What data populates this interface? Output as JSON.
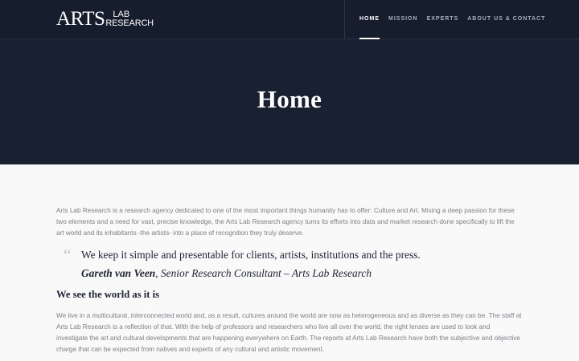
{
  "header": {
    "logo": {
      "arts": "ARTS",
      "lab": "LAB",
      "research": "RESEARCH"
    },
    "nav": [
      {
        "label": "HOME",
        "active": true
      },
      {
        "label": "MISSION",
        "active": false
      },
      {
        "label": "EXPERTS",
        "active": false
      },
      {
        "label": "ABOUT US & CONTACT",
        "active": false
      }
    ]
  },
  "hero": {
    "title": "Home"
  },
  "main": {
    "intro": "Arts Lab Research is a research agency dedicated to one of the most important things humanity has to offer: Culture and Art. Mixing a deep passion for these two elements and a need for vast, precise knowledge, the Arts Lab Research agency turns its efforts into data and market research done specifically to lift the art world and its inhabitants -the artists- into a place of recognition they truly deserve.",
    "quote": {
      "mark": "“",
      "text": "We keep it simple and presentable for clients, artists, institutions and the press.",
      "cite_name": "Gareth van Veen",
      "cite_role": ", Senior Research Consultant – Arts Lab Research"
    },
    "section_heading": "We see the world as it is",
    "body": "We live in a multicultural, interconnected world and, as a result, cultures around the world are now as heterogeneous and as diverse as they can be. The staff at Arts Lab Research is a reflection of that. With the help of professors and researchers who live all over the world, the right lenses are used to look and investigate the art and cultural developments that are happening everywhere on Earth. The reports at Arts Lab Research have both the subjective and objective charge that can be expected from natives and experts of any cultural and artistic movement."
  }
}
